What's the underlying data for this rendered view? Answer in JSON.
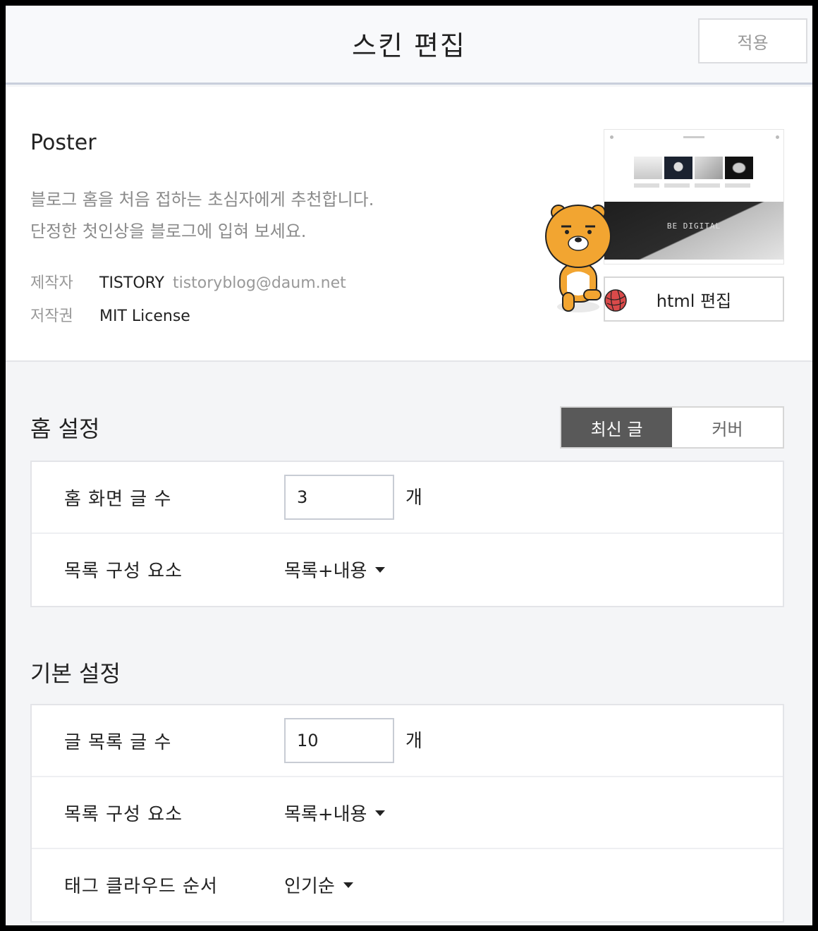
{
  "header": {
    "title": "스킨 편집",
    "apply_label": "적용"
  },
  "skin": {
    "name": "Poster",
    "description_line1": "블로그 홈을 처음 접하는 초심자에게 추천합니다.",
    "description_line2": "단정한 첫인상을 블로그에 입혀 보세요.",
    "author_label": "제작자",
    "author": "TISTORY",
    "author_email": "tistoryblog@daum.net",
    "license_label": "저작권",
    "license": "MIT License",
    "preview_banner_text": "BE DIGITAL",
    "html_edit_label": "html 편집"
  },
  "home_settings": {
    "title": "홈 설정",
    "modes": [
      {
        "label": "최신 글",
        "active": true
      },
      {
        "label": "커버",
        "active": false
      }
    ],
    "rows": [
      {
        "label": "홈 화면 글 수",
        "value": "3",
        "unit": "개"
      },
      {
        "label": "목록 구성 요소",
        "selected": "목록+내용"
      }
    ]
  },
  "basic_settings": {
    "title": "기본 설정",
    "rows": [
      {
        "label": "글 목록 글 수",
        "value": "10",
        "unit": "개"
      },
      {
        "label": "목록 구성 요소",
        "selected": "목록+내용"
      },
      {
        "label": "태그 클라우드 순서",
        "selected": "인기순"
      }
    ]
  },
  "colors": {
    "active_segment": "#595959",
    "mascot": "#f2a531"
  }
}
